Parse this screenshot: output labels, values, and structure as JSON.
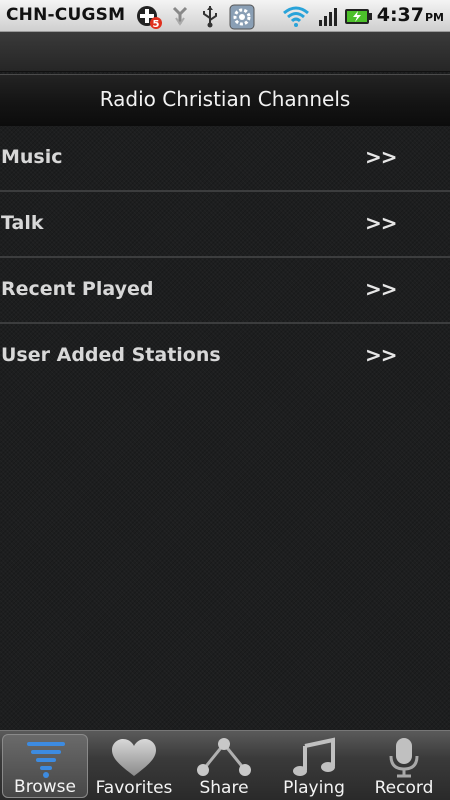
{
  "status_bar": {
    "carrier": "CHN-CUGSM",
    "badge_count": "5",
    "time": "4:37",
    "ampm": "PM",
    "icons": [
      "add-notification-icon",
      "transfer-icon",
      "usb-icon",
      "settings-icon",
      "wifi-icon",
      "signal-icon",
      "battery-charging-icon"
    ]
  },
  "header": {
    "title": "Radio Christian Channels"
  },
  "list": {
    "items": [
      {
        "label": "Music",
        "arrow": ">>"
      },
      {
        "label": "Talk",
        "arrow": ">>"
      },
      {
        "label": "Recent Played",
        "arrow": ">>"
      },
      {
        "label": "User Added Stations",
        "arrow": ">>"
      }
    ]
  },
  "tabs": {
    "items": [
      {
        "label": "Browse",
        "icon": "browse-icon",
        "active": true
      },
      {
        "label": "Favorites",
        "icon": "heart-icon",
        "active": false
      },
      {
        "label": "Share",
        "icon": "share-icon",
        "active": false
      },
      {
        "label": "Playing",
        "icon": "music-note-icon",
        "active": false
      },
      {
        "label": "Record",
        "icon": "microphone-icon",
        "active": false
      }
    ]
  },
  "colors": {
    "status_bar_bg": "#e4e4e4",
    "background": "#1d1e1f",
    "title_text": "#f2f2f2",
    "row_text": "#d8d8d8",
    "divider": "#3c3d3e",
    "browse_icon_accent": "#3d8be0",
    "battery_charge": "#4cc02a"
  }
}
